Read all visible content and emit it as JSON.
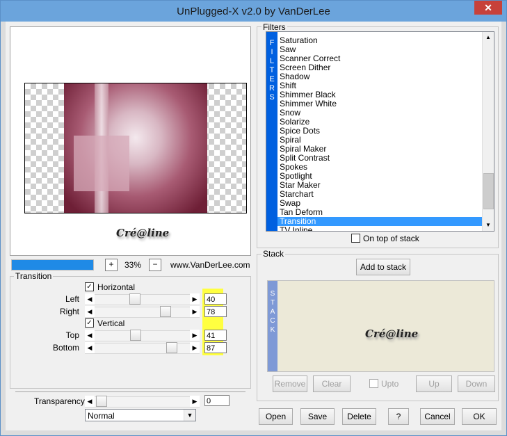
{
  "window": {
    "title": "UnPlugged-X v2.0 by VanDerLee",
    "close_glyph": "✕"
  },
  "preview": {
    "signature": "Cré@line"
  },
  "zoom": {
    "plus": "+",
    "minus": "−",
    "value": "33%",
    "progress_fraction": 1.0,
    "site": "www.VanDerLee.com"
  },
  "filters": {
    "legend": "Filters",
    "vertical_label": [
      "F",
      "I",
      "L",
      "T",
      "E",
      "R",
      "S"
    ],
    "items": [
      "Saturation",
      "Saw",
      "Scanner Correct",
      "Screen Dither",
      "Shadow",
      "Shift",
      "Shimmer Black",
      "Shimmer White",
      "Snow",
      "Solarize",
      "Spice Dots",
      "Spiral",
      "Spiral Maker",
      "Split Contrast",
      "Spokes",
      "Spotlight",
      "Star Maker",
      "Starchart",
      "Swap",
      "Tan Deform",
      "Transition",
      "TV Inline"
    ],
    "selected": "Transition",
    "on_top_label": "On top of stack"
  },
  "stack": {
    "legend": "Stack",
    "add_label": "Add to stack",
    "vertical_label": [
      "S",
      "T",
      "A",
      "C",
      "K"
    ],
    "signature": "Cré@line",
    "remove": "Remove",
    "clear": "Clear",
    "upto": "Upto",
    "up": "Up",
    "down": "Down"
  },
  "transition": {
    "legend": "Transition",
    "horizontal_label": "Horizontal",
    "vertical_label": "Vertical",
    "params": [
      {
        "label": "Left",
        "value": "40"
      },
      {
        "label": "Right",
        "value": "78"
      },
      {
        "label": "Top",
        "value": "41"
      },
      {
        "label": "Bottom",
        "value": "87"
      }
    ]
  },
  "transparency": {
    "label": "Transparency",
    "value": "0",
    "blend": "Normal"
  },
  "buttons": {
    "open": "Open",
    "save": "Save",
    "delete": "Delete",
    "help": "?",
    "cancel": "Cancel",
    "ok": "OK"
  },
  "colors": {
    "title_bar": "#6ba4dc",
    "selection": "#3399ff",
    "filters_bar": "#0060e0",
    "highlight": "#ffff40"
  }
}
